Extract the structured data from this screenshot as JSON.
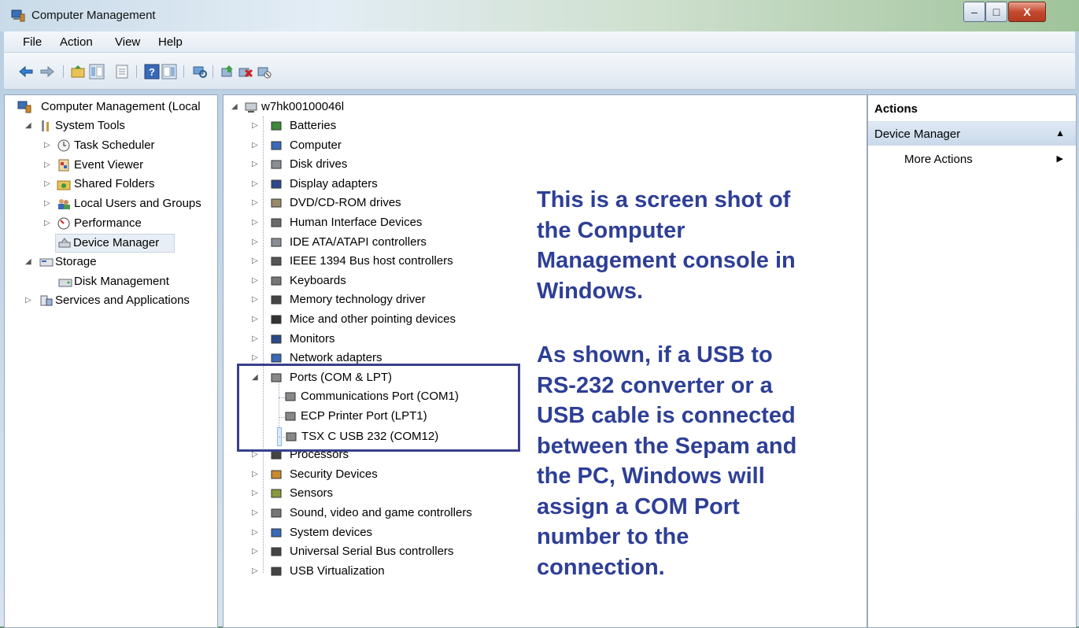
{
  "window": {
    "title": "Computer Management",
    "minimize_glyph": "–",
    "maximize_glyph": "□",
    "close_glyph": "X"
  },
  "menu": [
    "File",
    "Action",
    "View",
    "Help"
  ],
  "toolbar_icons": [
    "back-arrow-icon",
    "forward-arrow-icon",
    "up-folder-icon",
    "show-hide-tree-icon",
    "properties-icon",
    "help-icon",
    "show-hide-action-pane-icon",
    "scan-hardware-icon",
    "update-driver-icon",
    "uninstall-icon",
    "disable-device-icon"
  ],
  "left_tree": {
    "root": "Computer Management (Local",
    "system_tools": "System Tools",
    "task_scheduler": "Task Scheduler",
    "event_viewer": "Event Viewer",
    "shared_folders": "Shared Folders",
    "local_users": "Local Users and Groups",
    "performance": "Performance",
    "device_manager": "Device Manager",
    "storage": "Storage",
    "disk_management": "Disk Management",
    "services": "Services and Applications"
  },
  "device_tree": {
    "computer_name": "w7hk00100046l",
    "categories": [
      {
        "label": "Batteries",
        "icon": "battery-icon"
      },
      {
        "label": "Computer",
        "icon": "computer-icon"
      },
      {
        "label": "Disk drives",
        "icon": "disk-drive-icon"
      },
      {
        "label": "Display adapters",
        "icon": "display-adapter-icon"
      },
      {
        "label": "DVD/CD-ROM drives",
        "icon": "dvd-drive-icon"
      },
      {
        "label": "Human Interface Devices",
        "icon": "hid-icon"
      },
      {
        "label": "IDE ATA/ATAPI controllers",
        "icon": "ide-controller-icon"
      },
      {
        "label": "IEEE 1394 Bus host controllers",
        "icon": "firewire-icon"
      },
      {
        "label": "Keyboards",
        "icon": "keyboard-icon"
      },
      {
        "label": "Memory technology driver",
        "icon": "memory-icon"
      },
      {
        "label": "Mice and other pointing devices",
        "icon": "mouse-icon"
      },
      {
        "label": "Monitors",
        "icon": "monitor-icon"
      },
      {
        "label": "Network adapters",
        "icon": "network-adapter-icon"
      },
      {
        "label": "Ports (COM & LPT)",
        "icon": "port-icon"
      },
      {
        "label": "Communications Port (COM1)",
        "icon": "port-icon"
      },
      {
        "label": "ECP Printer Port (LPT1)",
        "icon": "port-icon"
      },
      {
        "label": "TSX C USB 232 (COM12)",
        "icon": "port-icon"
      },
      {
        "label": "Processors",
        "icon": "processor-icon"
      },
      {
        "label": "Security Devices",
        "icon": "security-device-icon"
      },
      {
        "label": "Sensors",
        "icon": "sensor-icon"
      },
      {
        "label": "Sound, video and game controllers",
        "icon": "sound-icon"
      },
      {
        "label": "System devices",
        "icon": "system-device-icon"
      },
      {
        "label": "Universal Serial Bus controllers",
        "icon": "usb-icon"
      },
      {
        "label": "USB Virtualization",
        "icon": "usb-icon"
      }
    ]
  },
  "annotation": {
    "p1_l1": "This is a screen shot of",
    "p1_l2": "the Computer",
    "p1_l3": "Management console in",
    "p1_l4": "Windows.",
    "p2_l1": "As shown, if a USB to",
    "p2_l2": "RS-232 converter or a",
    "p2_l3": "USB cable is connected",
    "p2_l4": "between the Sepam and",
    "p2_l5": "the PC, Windows will",
    "p2_l6": "assign a COM Port",
    "p2_l7": "number to the",
    "p2_l8": "connection."
  },
  "actions": {
    "header": "Actions",
    "section": "Device Manager",
    "section_glyph": "▲",
    "more": "More Actions",
    "more_glyph": "▶"
  },
  "colors": {
    "annotation_text": "#2e3f96",
    "highlight_box": "#3a3f8f"
  }
}
